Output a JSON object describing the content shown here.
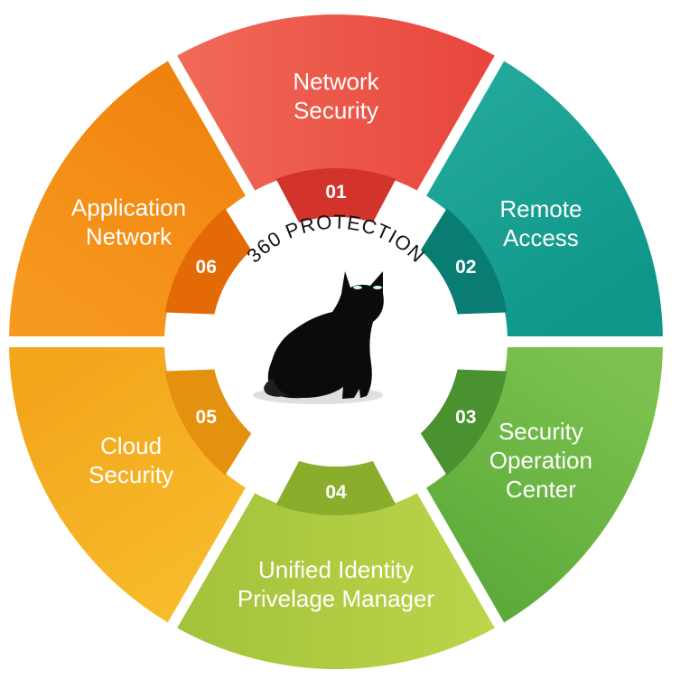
{
  "center": {
    "title": "360 PROTECTION",
    "emblem": "black-cat-icon"
  },
  "segments": [
    {
      "number": "01",
      "lines": [
        "Network",
        "Security"
      ],
      "color": "#E8453C",
      "color_light": "#F06A58",
      "inner_color": "#D2332A"
    },
    {
      "number": "02",
      "lines": [
        "Remote",
        "Access"
      ],
      "color": "#0E9688",
      "color_light": "#22A99B",
      "inner_color": "#0A7D72"
    },
    {
      "number": "03",
      "lines": [
        "Security",
        "Operation",
        "Center"
      ],
      "color": "#5BAA3A",
      "color_light": "#7CC14E",
      "inner_color": "#4A9230"
    },
    {
      "number": "04",
      "lines": [
        "Unified Identity",
        "Privelage Manager"
      ],
      "color": "#A2C23A",
      "color_light": "#BCD54A",
      "inner_color": "#8AAE2C"
    },
    {
      "number": "05",
      "lines": [
        "Cloud",
        "Security"
      ],
      "color": "#F3A51C",
      "color_light": "#F7BC2B",
      "inner_color": "#E59110"
    },
    {
      "number": "06",
      "lines": [
        "Application",
        "Network"
      ],
      "color": "#F0820E",
      "color_light": "#F7991E",
      "inner_color": "#E36A06"
    }
  ]
}
